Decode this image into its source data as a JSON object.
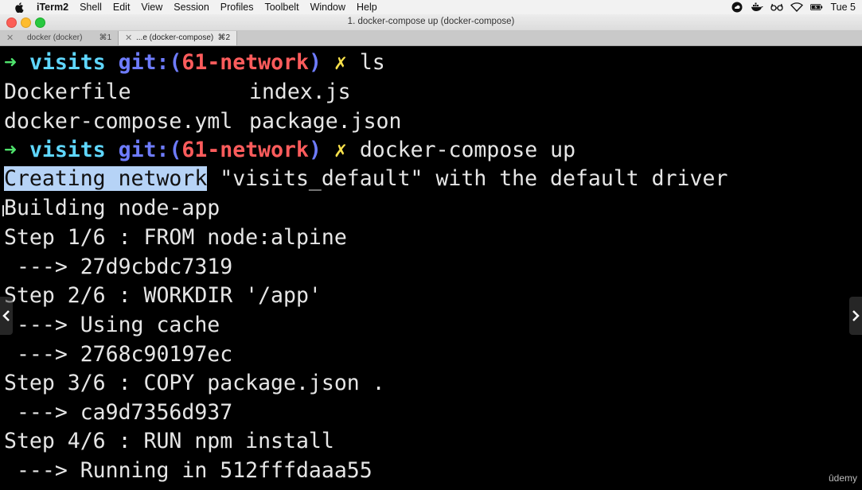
{
  "menubar": {
    "app_name": "iTerm2",
    "items": [
      "Shell",
      "Edit",
      "View",
      "Session",
      "Profiles",
      "Toolbelt",
      "Window",
      "Help"
    ],
    "status_icons": [
      "creative-cloud-icon",
      "docker-whale-icon",
      "glasses-icon",
      "wifi-icon",
      "battery-icon"
    ],
    "clock": "Tue 5"
  },
  "window": {
    "title": "1. docker-compose up (docker-compose)"
  },
  "tabs": [
    {
      "label": "docker (docker)",
      "shortcut": "⌘1"
    },
    {
      "label": "...e (docker-compose)",
      "shortcut": "⌘2"
    }
  ],
  "terminal": {
    "prompt1": {
      "arrow": "➜",
      "dir": "visits",
      "git": "git:(",
      "branch": "61-network",
      "git_close": ")",
      "dirty": "✗",
      "command": "ls"
    },
    "ls_row1": {
      "col1": "Dockerfile",
      "col2": "index.js"
    },
    "ls_row2": {
      "col1": "docker-compose.yml",
      "col2": "package.json"
    },
    "prompt2": {
      "arrow": "➜",
      "dir": "visits",
      "git": "git:(",
      "branch": "61-network",
      "git_close": ")",
      "dirty": "✗",
      "command": "docker-compose up"
    },
    "creating_selected": "Creating network",
    "creating_rest": " \"visits_default\" with the default driver",
    "lines": [
      "Building node-app",
      "Step 1/6 : FROM node:alpine",
      " ---> 27d9cbdc7319",
      "Step 2/6 : WORKDIR '/app'",
      " ---> Using cache",
      " ---> 2768c90197ec",
      "Step 3/6 : COPY package.json .",
      " ---> ca9d7356d937",
      "Step 4/6 : RUN npm install",
      " ---> Running in 512fffdaaa55"
    ]
  },
  "watermark": "ûdemy"
}
